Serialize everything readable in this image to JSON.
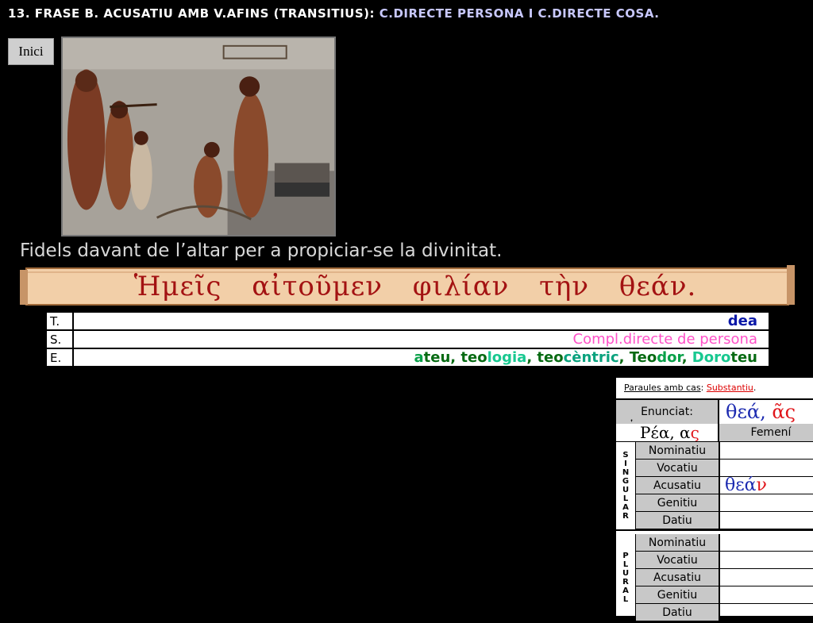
{
  "header": {
    "title_prefix": "13. FRASE B. ACUSATIU AMB V.AFINS (TRANSITIUS):",
    "title_highlight": "C.DIRECTE PERSONA I C.DIRECTE COSA."
  },
  "nav": {
    "home_label": "Inici"
  },
  "caption": "Fidels davant de l’altar per a propiciar-se la divinitat.",
  "greek_sentence": "Ἡμεῖς αἰτοῦμεν φιλίαν τὴν θεάν.",
  "tse_table": {
    "rows": [
      {
        "label": "T.",
        "value": "dea"
      },
      {
        "label": "S.",
        "value": "Compl.directe de persona"
      },
      {
        "label": "E.",
        "parts": [
          "a",
          "teu",
          ", ",
          "teo",
          "logia",
          ", ",
          "teo",
          "cèntric",
          ", ",
          "Teo",
          "dor",
          ", ",
          "Doro",
          "teu"
        ]
      }
    ]
  },
  "panel": {
    "header_label": "Paraules amb cas",
    "header_sep": ":",
    "header_type": "Substantiu",
    "header_end": ".",
    "enunciat_label": "Enunciat:",
    "enunciat_stem": "θεά,",
    "enunciat_ending": "ᾶς",
    "model_spirit": "῾",
    "model_stem": "Ρέα,",
    "model_alpha": "α",
    "model_sigma": "ς",
    "gender": "Femení",
    "singular_letters": [
      "S",
      "I",
      "N",
      "G",
      "U",
      "L",
      "A",
      "R"
    ],
    "plural_letters": [
      "P",
      "L",
      "U",
      "R",
      "A",
      "L"
    ],
    "cases": [
      "Nominatiu",
      "Vocatiu",
      "Acusatiu",
      "Genitiu",
      "Datiu"
    ],
    "accusative_stem": "θεά",
    "accusative_ending": "ν"
  },
  "colors": {
    "background": "#000000",
    "highlight": "#c8c8ff",
    "greek_text": "#a31212",
    "scroll": "#f2cfa8",
    "dea": "#0b18a8",
    "persona": "#ff50c8",
    "panel_red": "#e0151a"
  },
  "icons": {
    "photo": "vase-painting-image",
    "scroll": "parchment-scroll"
  }
}
